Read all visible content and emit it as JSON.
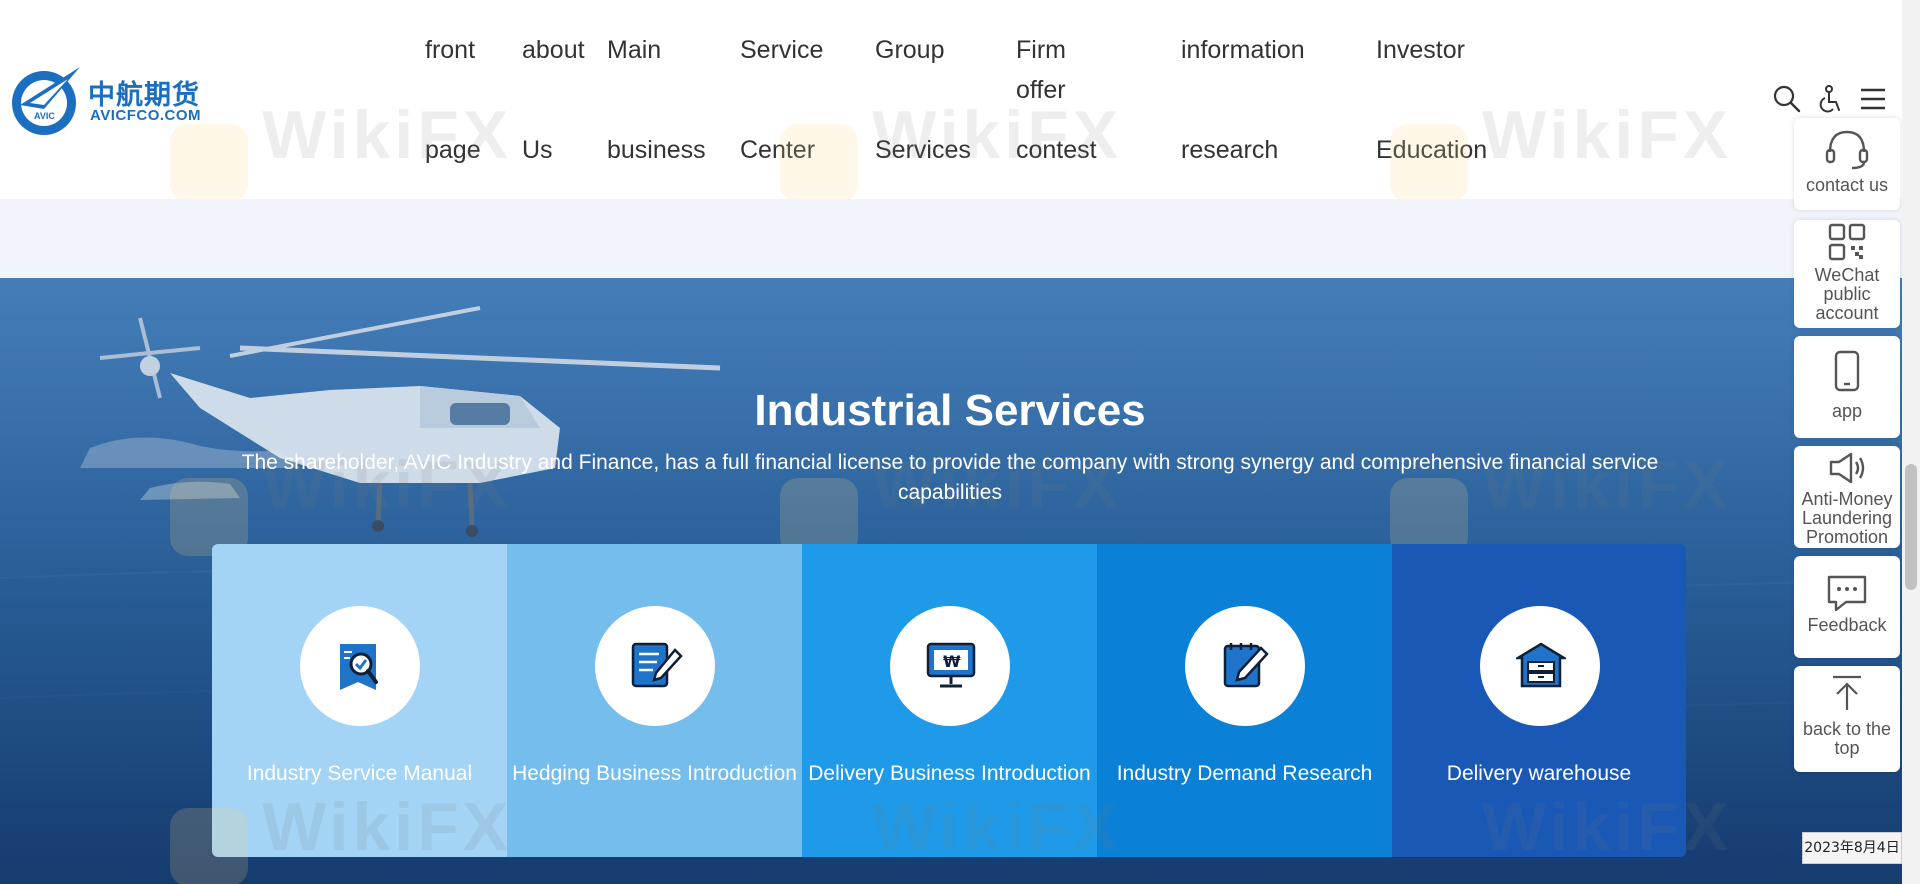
{
  "header": {
    "logo_cn": "中航期货",
    "logo_en": "AVICFCO.COM",
    "logo_badge": "AVIC",
    "nav": [
      {
        "line1": "front",
        "line2": "page"
      },
      {
        "line1": "about",
        "line2": "Us"
      },
      {
        "line1": "Main",
        "line2": "business"
      },
      {
        "line1": "Service",
        "line2": "Center"
      },
      {
        "line1": "Group",
        "line2": "Services"
      },
      {
        "line1": "Firm offer",
        "line2": "contest"
      },
      {
        "line1": "information",
        "line2": "research"
      },
      {
        "line1": "Investor",
        "line2": "Education"
      }
    ],
    "tools": [
      "search-icon",
      "accessibility-icon",
      "menu-icon"
    ]
  },
  "section": {
    "title": "Industrial Services",
    "subtitle": "The shareholder, AVIC Industry and Finance, has a full financial license to provide the company with strong synergy and comprehensive financial service capabilities",
    "cards": [
      {
        "label": "Industry Service Manual",
        "icon": "manual-search-icon",
        "color": "#a3d4f5"
      },
      {
        "label": "Hedging Business Introduction",
        "icon": "document-edit-icon",
        "color": "#75bdec"
      },
      {
        "label": "Delivery Business Introduction",
        "icon": "monitor-currency-icon",
        "color": "#1e9ae8"
      },
      {
        "label": "Industry Demand Research",
        "icon": "notepad-pen-icon",
        "color": "#0a80d6"
      },
      {
        "label": "Delivery warehouse",
        "icon": "warehouse-icon",
        "color": "#1a58b6"
      }
    ]
  },
  "sidebar": [
    {
      "label": "contact us",
      "icon": "headset-icon"
    },
    {
      "label": "WeChat public account",
      "icon": "qr-code-icon"
    },
    {
      "label": "app",
      "icon": "mobile-phone-icon"
    },
    {
      "label": "Anti-Money Laundering Promotion",
      "icon": "megaphone-icon"
    },
    {
      "label": "Feedback",
      "icon": "chat-bubble-icon"
    },
    {
      "label": "back to the top",
      "icon": "arrow-up-icon"
    }
  ],
  "watermark": "WikiFX",
  "date_badge": "2023年8月4日",
  "colors": {
    "brand_blue": "#1a6fc1",
    "hero_blue": "#215b98",
    "band": "#f1f5fb"
  }
}
